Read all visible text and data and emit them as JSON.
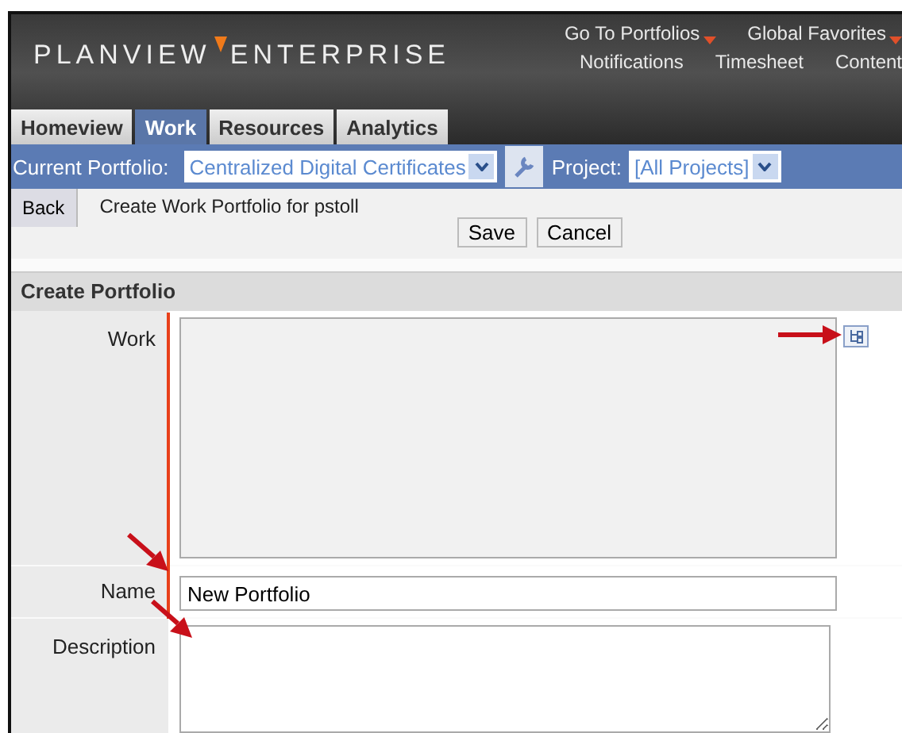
{
  "logo": {
    "word_1": "PLANVIEW",
    "word_2": "ENTERPRISE"
  },
  "top_links": [
    {
      "label": "Go To Portfolios",
      "dropdown": true
    },
    {
      "label": "Global Favorites",
      "dropdown": true
    }
  ],
  "top_links_2": [
    "Notifications",
    "Timesheet",
    "Content"
  ],
  "tabs": [
    {
      "label": "Homeview",
      "selected": false
    },
    {
      "label": "Work",
      "selected": true
    },
    {
      "label": "Resources",
      "selected": false
    },
    {
      "label": "Analytics",
      "selected": false
    }
  ],
  "portfolio_bar": {
    "label": "Current Portfolio:",
    "portfolio": "Centralized Digital Certificates",
    "project_label": "Project:",
    "project": "[All Projects]"
  },
  "toolbar": {
    "back": "Back",
    "title": "Create Work Portfolio for pstoll",
    "buttons": [
      "Save",
      "Cancel"
    ]
  },
  "section": {
    "title": "Create Portfolio",
    "fields": [
      {
        "kind": "list",
        "label": "Work"
      },
      {
        "kind": "text",
        "label": "Name",
        "value": "New Portfolio"
      },
      {
        "kind": "textarea",
        "label": "Description"
      }
    ]
  }
}
